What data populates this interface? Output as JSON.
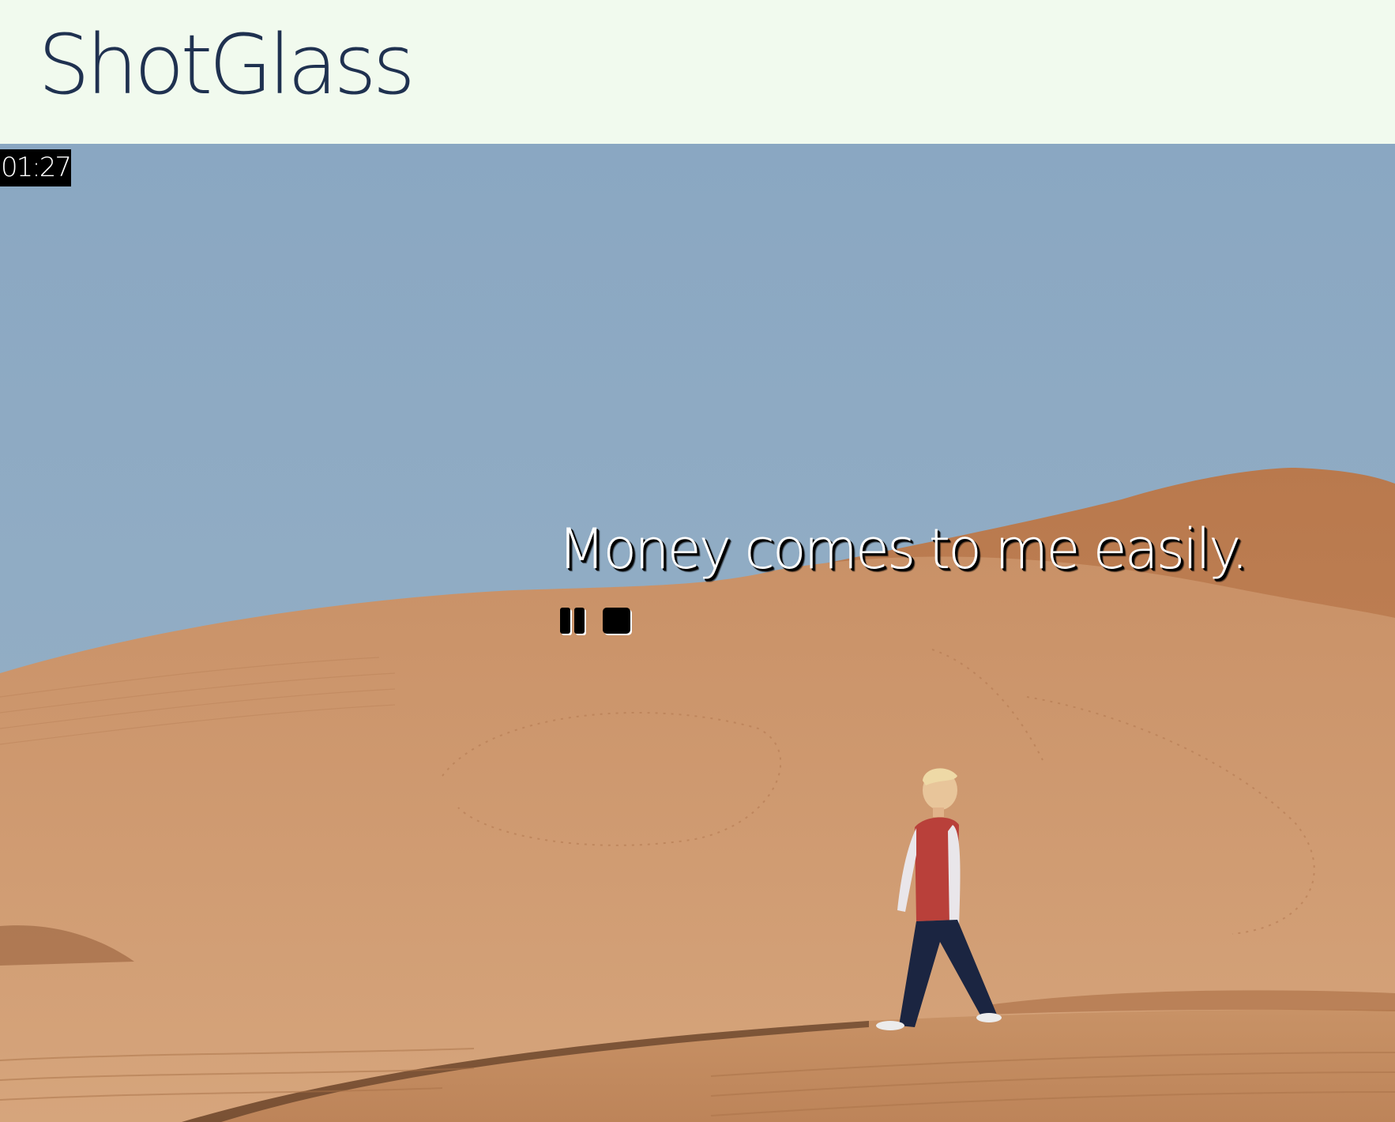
{
  "header": {
    "brand": "ShotGlass",
    "background_color": "#f1faee",
    "brand_color": "#1f3150"
  },
  "player": {
    "timer": "01:27",
    "affirmation": "Money comes to me easily.",
    "controls": [
      {
        "name": "pause",
        "icon": "pause-icon"
      },
      {
        "name": "stop",
        "icon": "stop-icon"
      }
    ]
  },
  "background": {
    "description_icon": "desert-photo",
    "sky_color": "#8eaac3",
    "sand_color": "#c8916a"
  }
}
